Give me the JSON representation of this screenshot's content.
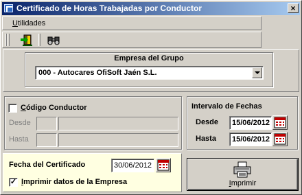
{
  "window": {
    "title": "Certificado de Horas Trabajadas por Conductor",
    "close_glyph": "×"
  },
  "menu": {
    "utilidades_label": "Utilidades",
    "utilidades_mnemonic": "U",
    "utilidades_rest": "tilidades"
  },
  "toolbar": {
    "buttons": [
      {
        "icon": "exit-door-icon"
      },
      {
        "icon": "binoculars-icon"
      }
    ]
  },
  "empresa": {
    "group_label": "Empresa del Grupo",
    "selected": "000 - Autocares OfiSoft Jaén S.L."
  },
  "conductor": {
    "checkbox_checked": false,
    "label_mnemonic": "C",
    "label_rest": "ódigo Conductor",
    "label": "Código Conductor",
    "desde_label": "Desde",
    "hasta_label": "Hasta",
    "desde_code": "",
    "desde_name": "",
    "hasta_code": "",
    "hasta_name": ""
  },
  "intervalo": {
    "title": "Intervalo de Fechas",
    "desde_label": "Desde",
    "desde_value": "15/06/2012",
    "hasta_label": "Hasta",
    "hasta_value": "15/06/2012"
  },
  "certificado": {
    "fecha_label": "Fecha del Certificado",
    "fecha_value": "30/06/2012",
    "imprimir_empresa_checked": true,
    "imprimir_empresa_mnemonic": "I",
    "imprimir_empresa_rest": "mprimir datos de la Empresa",
    "check_glyph": "✓"
  },
  "print_button": {
    "label_mnemonic": "I",
    "label_rest": "mprimir"
  },
  "colors": {
    "title_gradient_start": "#0a246a",
    "title_gradient_end": "#a6caf0",
    "face": "#d4d0c8",
    "cert_panel": "#ffffe1",
    "calendar_red": "#c00000"
  }
}
